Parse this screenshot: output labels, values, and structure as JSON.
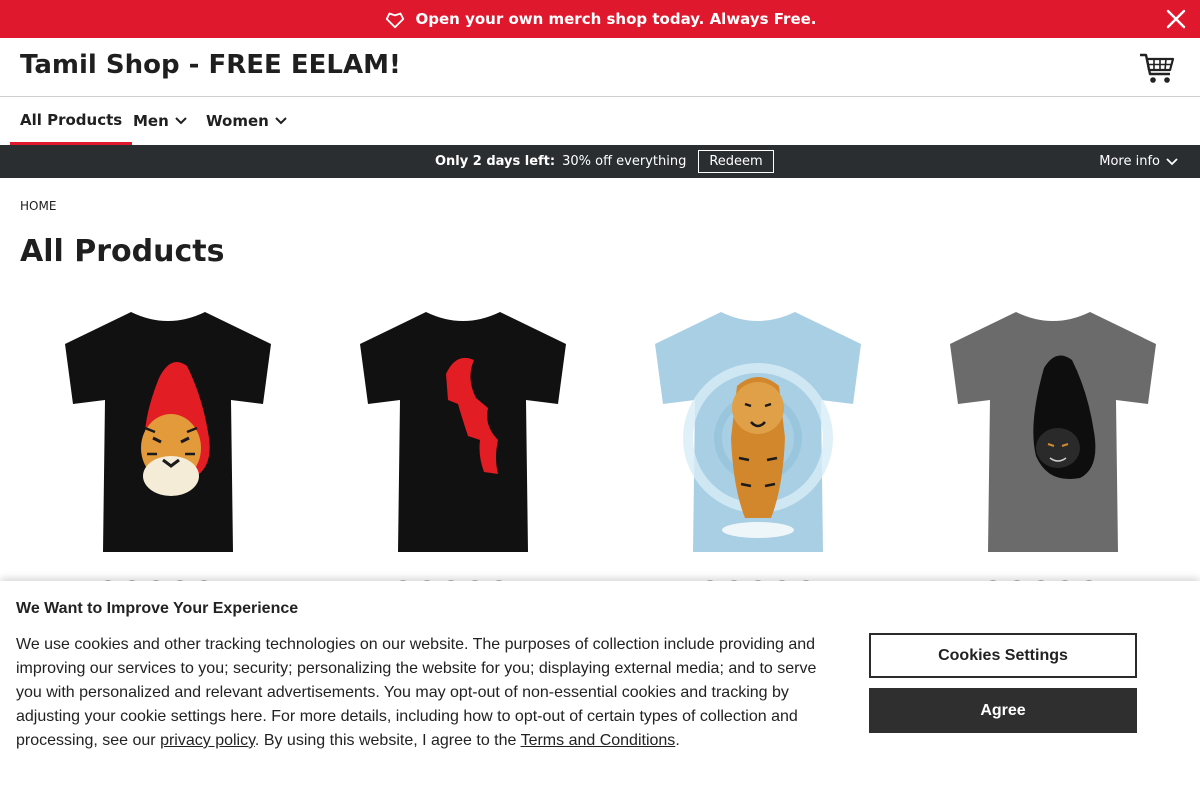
{
  "promo": {
    "text": "Open your own merch shop today. Always Free.",
    "icon": "tag-icon",
    "close_icon": "close-icon",
    "background": "#e0182d"
  },
  "header": {
    "shop_title": "Tamil Shop - FREE EELAM!",
    "cart_icon": "shopping-cart-icon"
  },
  "nav": {
    "items": [
      {
        "label": "All Products",
        "active": true
      },
      {
        "label": "Men",
        "has_dropdown": true
      },
      {
        "label": "Women",
        "has_dropdown": true
      }
    ]
  },
  "salebar": {
    "days_left": "Only 2 days left:",
    "discount": "30% off everything",
    "redeem": "Redeem",
    "more_info": "More info"
  },
  "breadcrumb": {
    "home": "HOME"
  },
  "page": {
    "title": "All Products"
  },
  "products": [
    {
      "shirt_color": "#111111",
      "design": "Red Sri Lanka map with tiger face"
    },
    {
      "shirt_color": "#111111",
      "design": "Red Tamil Eelam map"
    },
    {
      "shirt_color": "#a9cfe4",
      "design": "Walking tiger on tie-dye"
    },
    {
      "shirt_color": "#6b6b6b",
      "design": "Black Tamil Eelam map with tiger"
    }
  ],
  "cookie": {
    "title": "We Want to Improve Your Experience",
    "body_before": "We use cookies and other tracking technologies on our website. The purposes of collection include providing and improving our services to you; security; personalizing the website for you; displaying external media; and to serve you with personalized and relevant advertisements. You may opt-out of non-essential cookies and tracking by adjusting your cookie settings here. For more details, including how to opt-out of certain types of collection and processing, see our ",
    "privacy_link": "privacy policy",
    "body_middle": ". By using this website, I agree to the ",
    "terms_link": "Terms and Conditions",
    "body_after": ".",
    "settings_button": "Cookies Settings",
    "agree_button": "Agree"
  }
}
